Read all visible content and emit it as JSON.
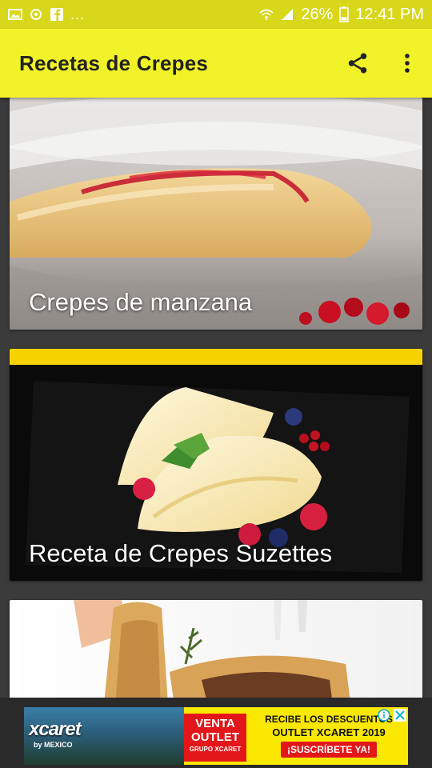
{
  "status_bar": {
    "overflow": "...",
    "battery": "26%",
    "time": "12:41 PM"
  },
  "app_bar": {
    "title": "Recetas de Crepes"
  },
  "recipes": [
    {
      "title": "Crepes de manzana"
    },
    {
      "title": "Receta de Crepes Suzettes"
    },
    {
      "title": ""
    }
  ],
  "ad": {
    "brand": "xcaret",
    "brand_sub": "by MEXICO",
    "venta_line1": "VENTA",
    "venta_line2": "OUTLET",
    "venta_line3": "GRUPO XCARET",
    "line1": "RECIBE LOS DESCUENTOS",
    "line2": "OUTLET XCARET 2019",
    "cta": "¡SUSCRÍBETE YA!"
  },
  "colors": {
    "status_bar": "#d8d71a",
    "app_bar": "#f2f229",
    "background": "#3b3b3b",
    "ad_yellow": "#fbe800",
    "ad_red": "#e3171a"
  },
  "icons": [
    "image-icon",
    "sync-icon",
    "facebook-icon",
    "wifi-icon",
    "signal-icon",
    "battery-icon",
    "share-icon",
    "more-vert-icon",
    "ad-info-icon",
    "ad-close-icon"
  ]
}
